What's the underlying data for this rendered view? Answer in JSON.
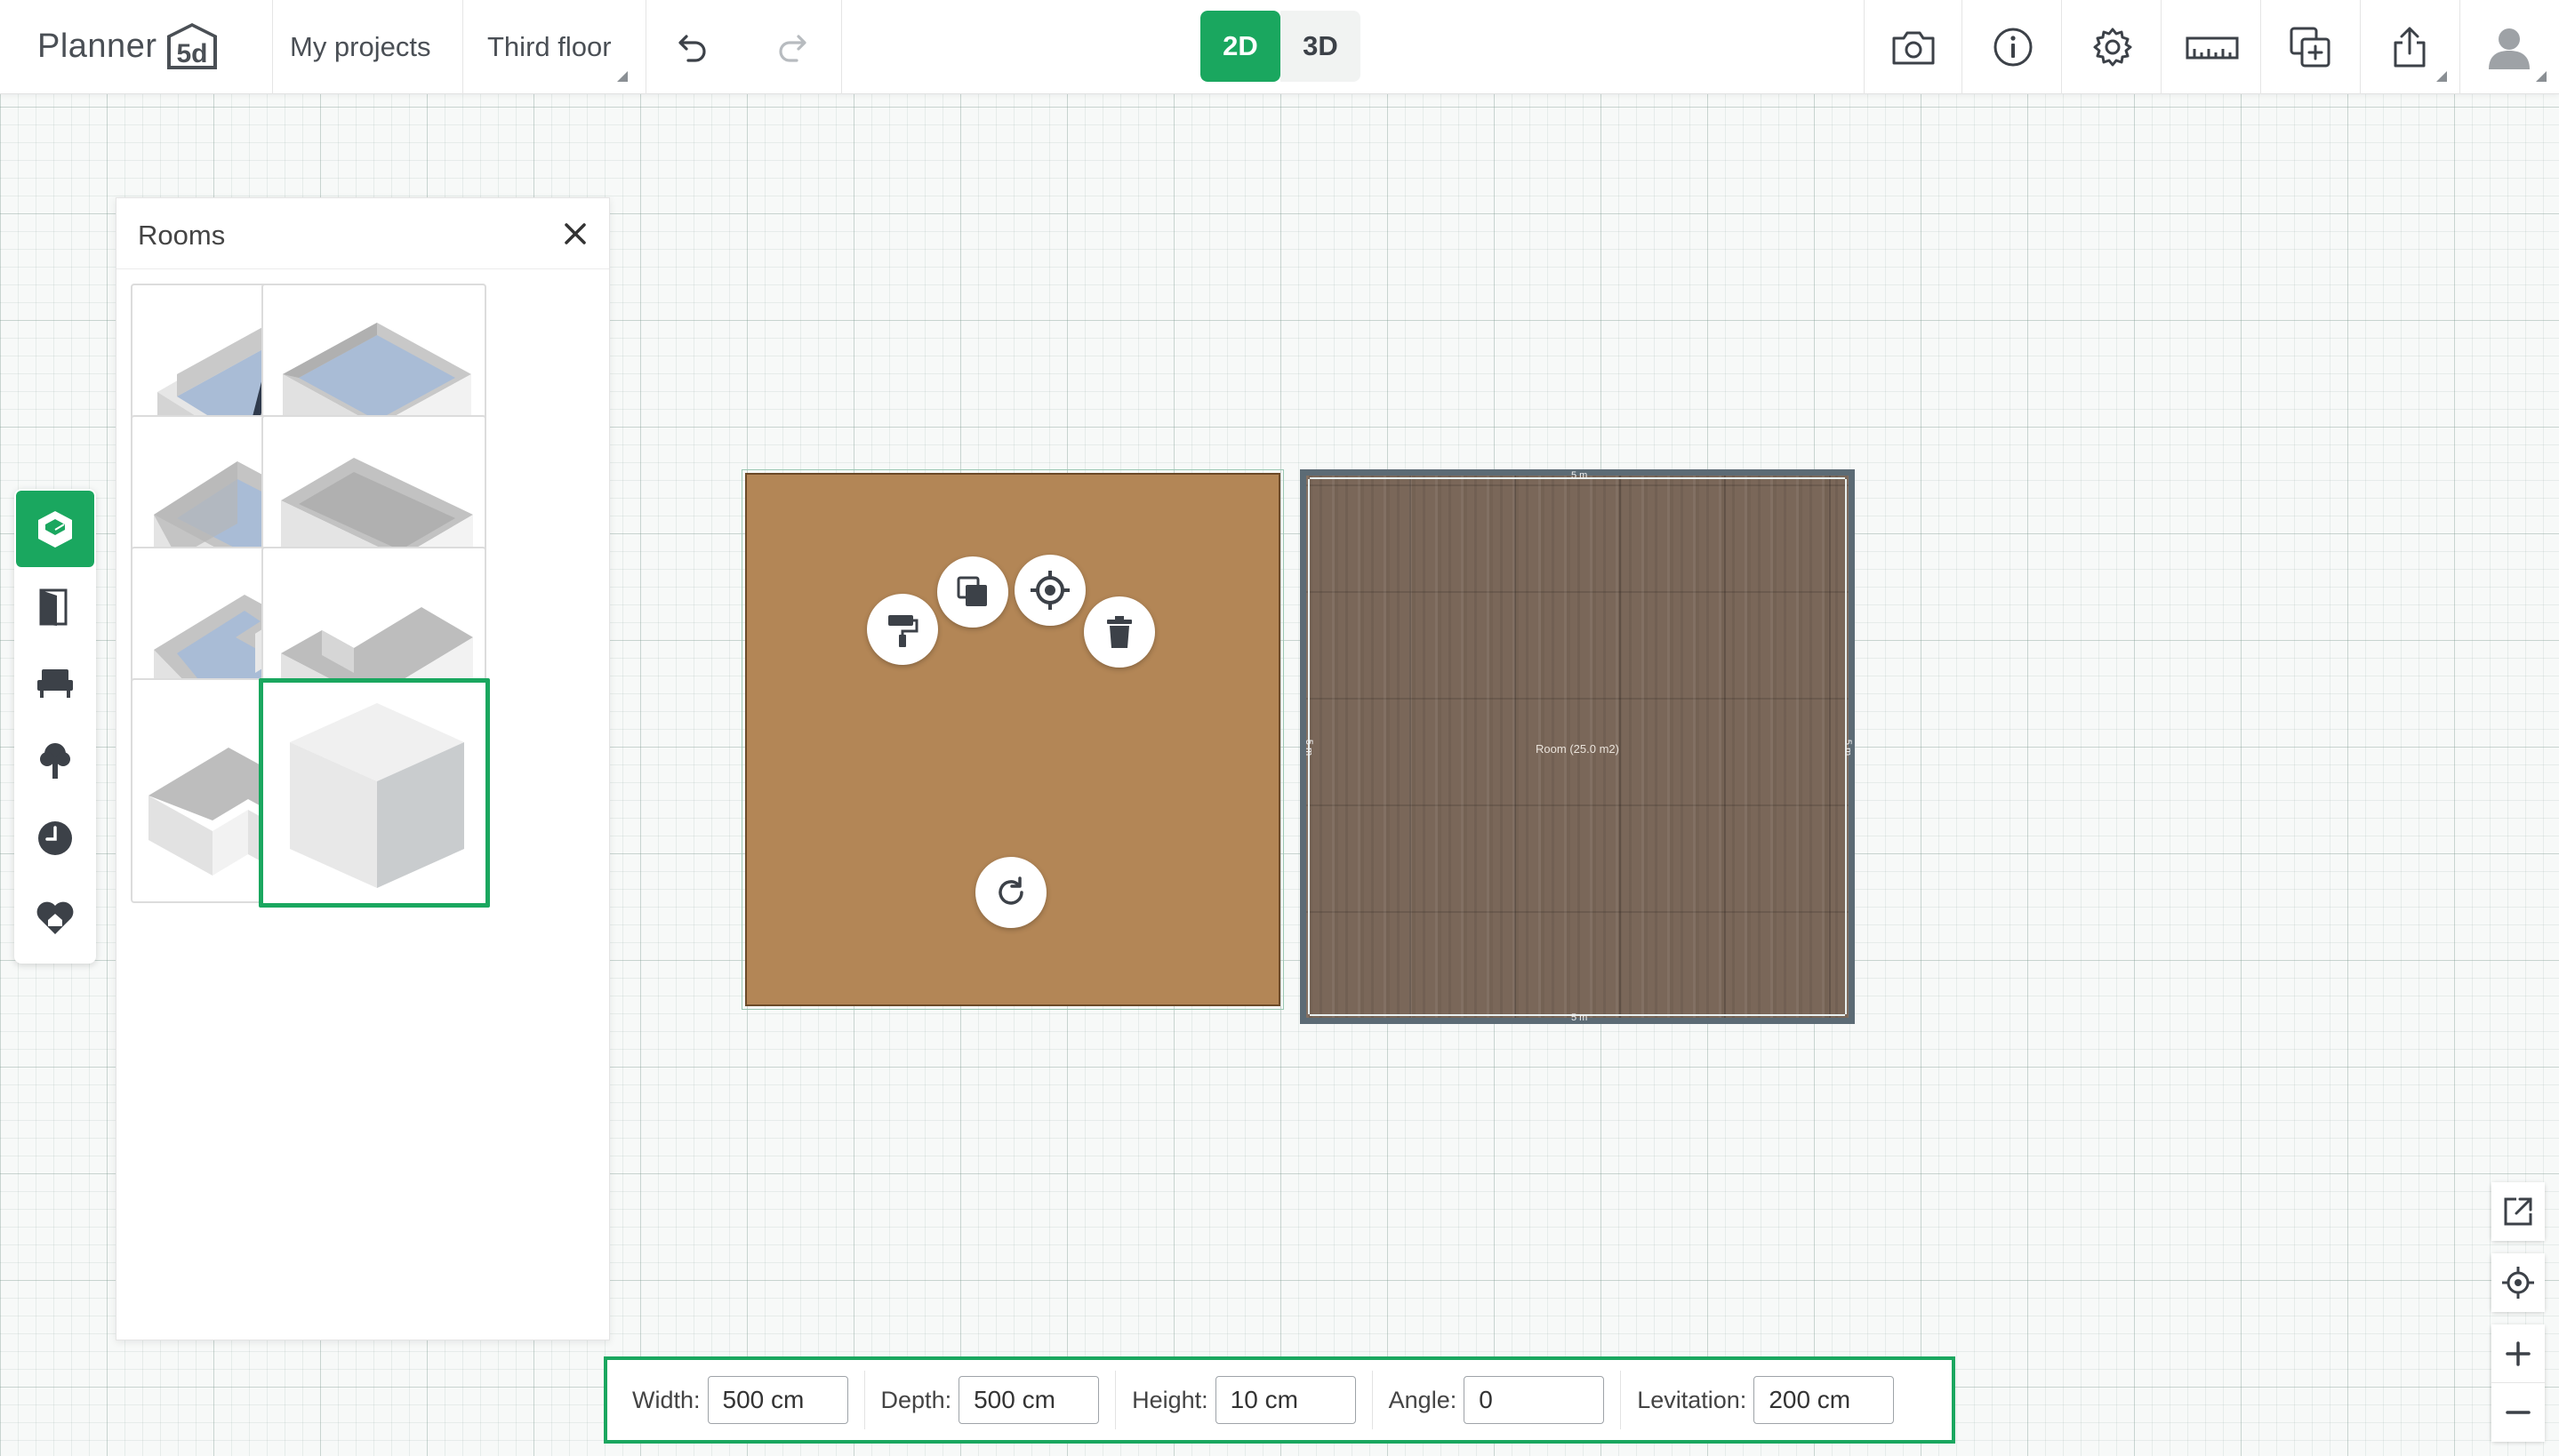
{
  "header": {
    "logo_text": "Planner",
    "logo_badge": "5d",
    "my_projects": "My projects",
    "floor": "Third floor",
    "view_2d": "2D",
    "view_3d": "3D"
  },
  "icons": {
    "undo": "undo-icon",
    "redo": "redo-icon",
    "camera": "camera-icon",
    "info": "info-icon",
    "settings": "gear-icon",
    "measure": "ruler-icon",
    "add_copy": "add-copy-icon",
    "share": "share-icon",
    "user": "user-avatar-icon"
  },
  "tools": [
    {
      "name": "rooms-tool",
      "icon": "room-cube-icon",
      "active": true
    },
    {
      "name": "doors-tool",
      "icon": "door-icon",
      "active": false
    },
    {
      "name": "furniture-tool",
      "icon": "sofa-icon",
      "active": false
    },
    {
      "name": "exterior-tool",
      "icon": "tree-icon",
      "active": false
    },
    {
      "name": "recent-tool",
      "icon": "clock-icon",
      "active": false
    },
    {
      "name": "favorites-tool",
      "icon": "heart-house-icon",
      "active": false
    }
  ],
  "rooms_panel": {
    "title": "Rooms",
    "tiles": [
      {
        "name": "room-wall-tool",
        "selected": false
      },
      {
        "name": "room-square",
        "selected": false
      },
      {
        "name": "room-rect-tall",
        "selected": false
      },
      {
        "name": "room-rect-wide",
        "selected": false
      },
      {
        "name": "room-l-notch",
        "selected": false
      },
      {
        "name": "room-l-shape",
        "selected": false
      },
      {
        "name": "room-l-corner",
        "selected": false
      },
      {
        "name": "room-solid-box",
        "selected": true
      }
    ]
  },
  "canvas": {
    "room_label": "Room (25.0 m2)",
    "dim_top": "5 m",
    "dim_bottom": "5 m",
    "dim_left": "5 m",
    "dim_right": "5 m",
    "selection_actions": [
      "paint-roller-icon",
      "duplicate-icon",
      "focus-icon",
      "trash-icon",
      "rotate-icon"
    ]
  },
  "properties": {
    "width_label": "Width:",
    "width_value": "500 cm",
    "depth_label": "Depth:",
    "depth_value": "500 cm",
    "height_label": "Height:",
    "height_value": "10 cm",
    "angle_label": "Angle:",
    "angle_value": "0",
    "levitation_label": "Levitation:",
    "levitation_value": "200 cm"
  },
  "colors": {
    "accent": "#1aa75f",
    "box_fill": "#b38656",
    "wood_floor": "#7a6759",
    "icon": "#3c4148"
  }
}
